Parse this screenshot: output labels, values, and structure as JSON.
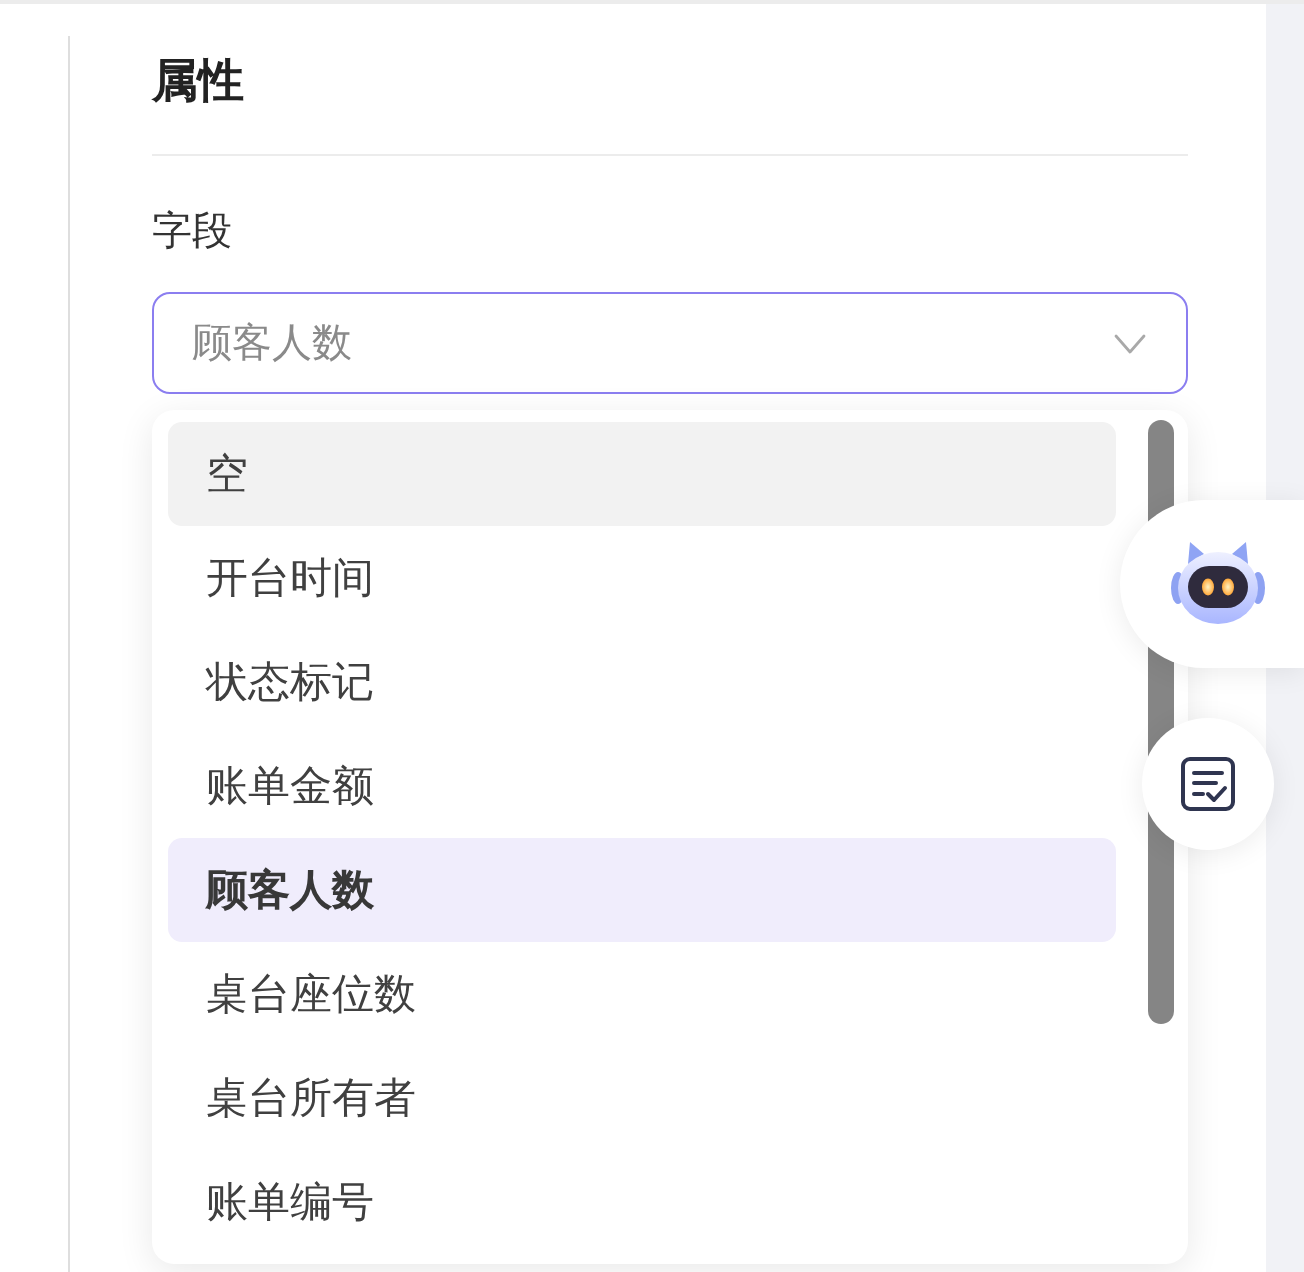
{
  "panel": {
    "title": "属性"
  },
  "field": {
    "label": "字段",
    "select": {
      "value": "顾客人数",
      "open": true
    }
  },
  "dropdown": {
    "options": [
      {
        "label": "空",
        "selected": false,
        "hovered": true
      },
      {
        "label": "开台时间",
        "selected": false,
        "hovered": false
      },
      {
        "label": "状态标记",
        "selected": false,
        "hovered": false
      },
      {
        "label": "账单金额",
        "selected": false,
        "hovered": false
      },
      {
        "label": "顾客人数",
        "selected": true,
        "hovered": false
      },
      {
        "label": "桌台座位数",
        "selected": false,
        "hovered": false
      },
      {
        "label": "桌台所有者",
        "selected": false,
        "hovered": false
      },
      {
        "label": "账单编号",
        "selected": false,
        "hovered": false
      }
    ]
  },
  "floating_buttons": [
    {
      "kind": "assistant"
    },
    {
      "kind": "checklist"
    }
  ]
}
